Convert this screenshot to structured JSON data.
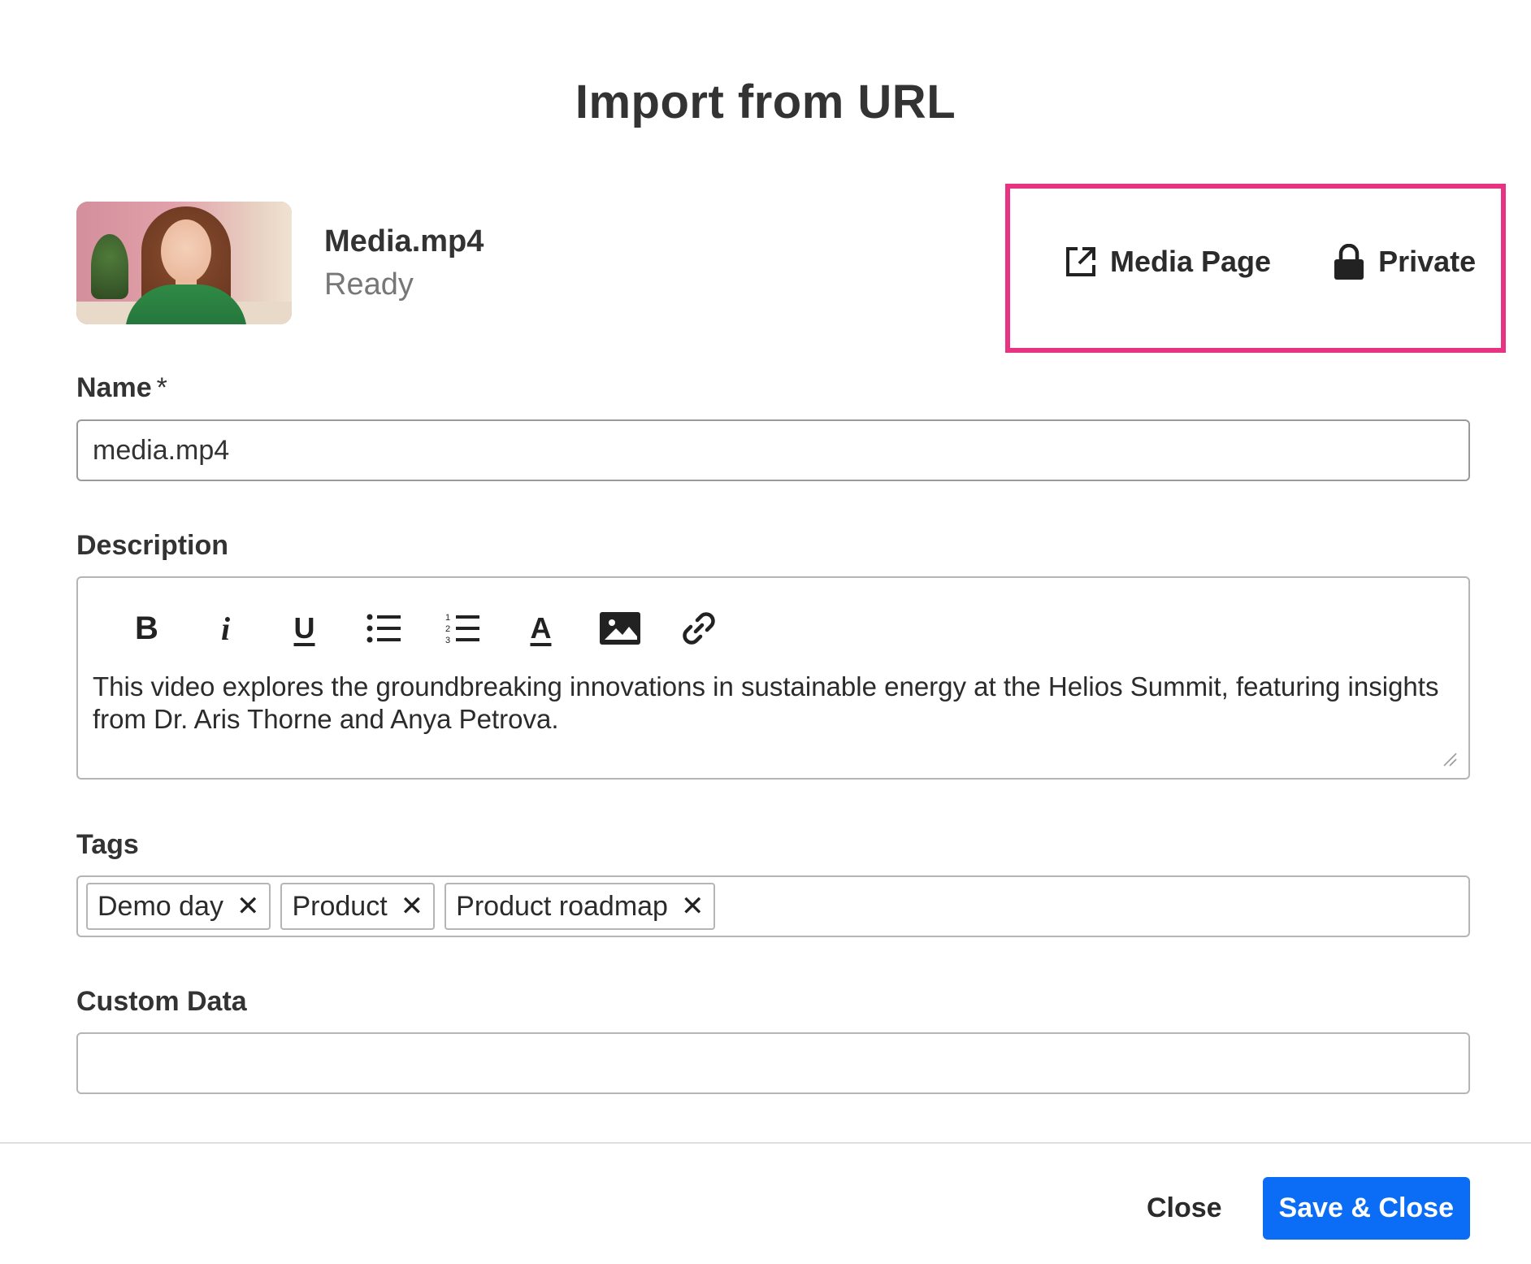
{
  "dialog": {
    "title": "Import from URL"
  },
  "media": {
    "name": "Media.mp4",
    "status": "Ready",
    "actions": {
      "media_page_label": "Media Page",
      "media_page_icon": "external-link-icon",
      "privacy_label": "Private",
      "privacy_icon": "lock-icon"
    }
  },
  "form": {
    "name": {
      "label": "Name",
      "required_marker": "*",
      "value": "media.mp4"
    },
    "description": {
      "label": "Description",
      "toolbar": {
        "bold": "B",
        "italic": "i",
        "underline": "U",
        "text_color": "A"
      },
      "value": "This video explores the groundbreaking innovations in sustainable energy at the Helios Summit, featuring insights from Dr. Aris Thorne and Anya Petrova."
    },
    "tags": {
      "label": "Tags",
      "items": [
        "Demo day",
        "Product",
        "Product roadmap"
      ],
      "remove_glyph": "✕"
    },
    "custom_data": {
      "label": "Custom Data",
      "value": ""
    }
  },
  "footer": {
    "close_label": "Close",
    "save_label": "Save & Close",
    "save_color": "#0b6df5"
  },
  "highlight_color": "#e83282"
}
